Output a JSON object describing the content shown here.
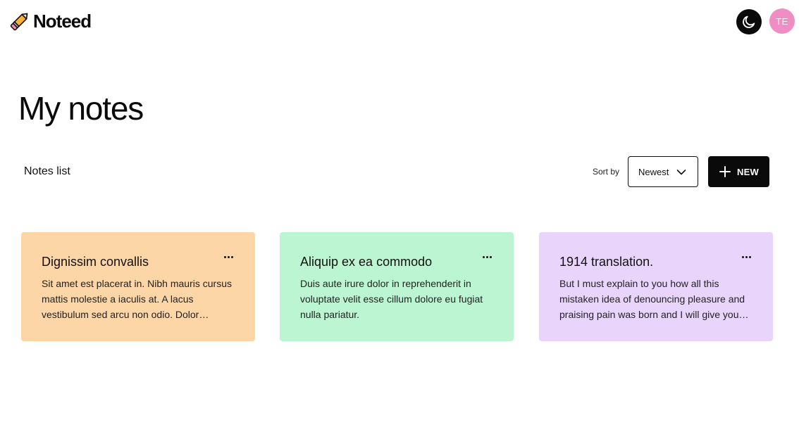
{
  "header": {
    "app_name": "Noteed",
    "logo_icon": "pencil-icon",
    "theme_icon": "moon-icon",
    "avatar_initials": "TE",
    "avatar_color": "#ee8ec4"
  },
  "main": {
    "title": "My notes",
    "list_label": "Notes list",
    "sort": {
      "label": "Sort by",
      "value": "Newest"
    },
    "new_button_label": "NEW"
  },
  "notes": [
    {
      "title": "Dignissim convallis",
      "body": "Sit amet est placerat in. Nibh mauris cursus mattis molestie a iaculis at. A lacus vestibulum sed arcu non odio. Dolor morbi…",
      "color": "#fdd6a8"
    },
    {
      "title": "Aliquip ex ea commodo",
      "body": "Duis aute irure dolor in reprehenderit in voluptate velit esse cillum dolore eu fugiat nulla pariatur.",
      "color": "#bbf5d1"
    },
    {
      "title": "1914 translation.",
      "body": "But I must explain to you how all this mistaken idea of denouncing pleasure and praising pain was born and I will give you a…",
      "color": "#e9d5fc"
    }
  ]
}
